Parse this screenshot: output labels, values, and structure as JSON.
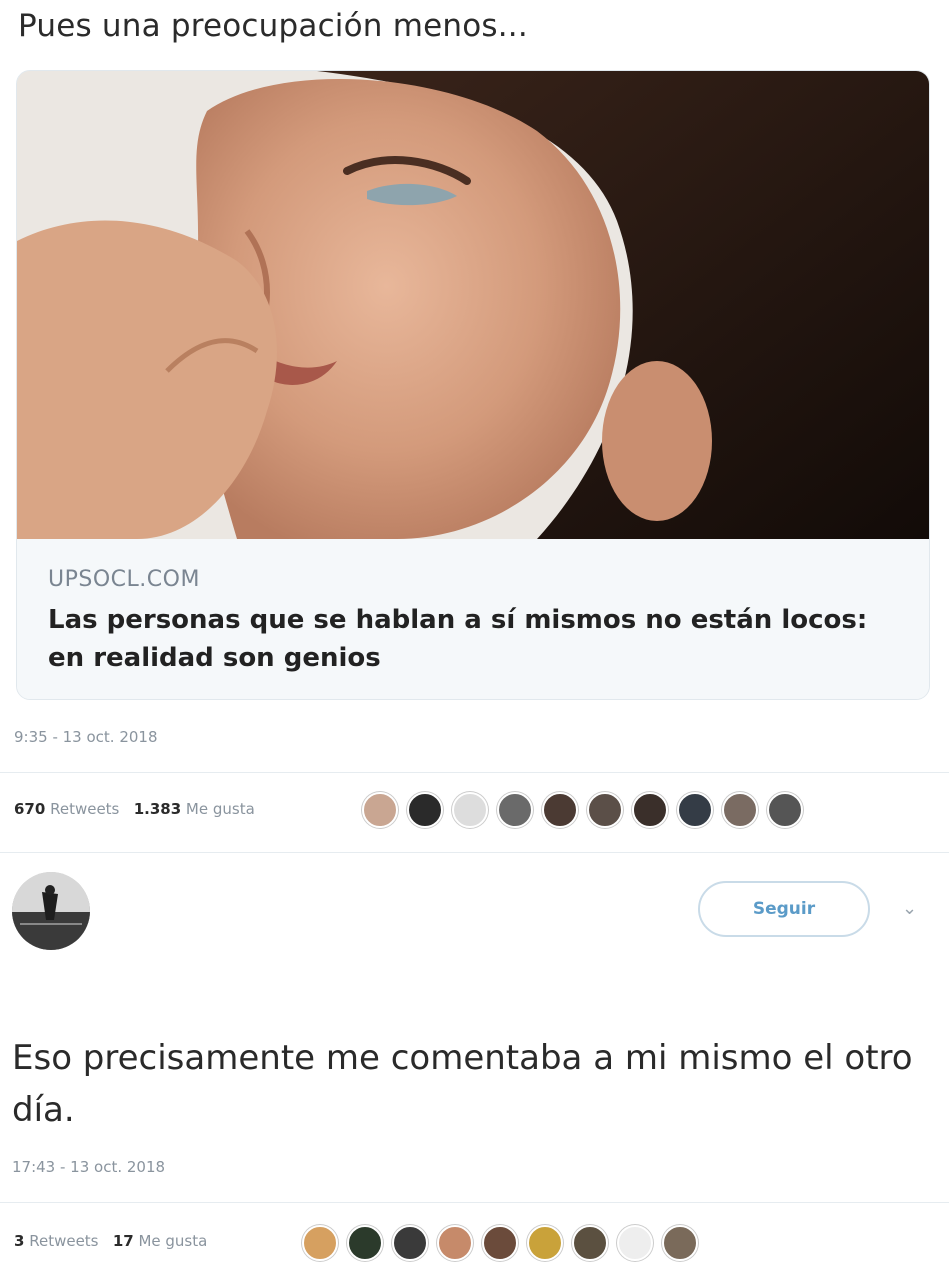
{
  "tweet": {
    "text": "Pues una preocupación menos...",
    "card": {
      "domain": "UPSOCL.COM",
      "title": "Las personas que se hablan a sí mismos no están locos: en realidad son genios"
    },
    "timestamp": "9:35 - 13 oct. 2018",
    "retweets_count": "670",
    "retweets_label": "Retweets",
    "likes_count": "1.383",
    "likes_label": "Me gusta"
  },
  "reply": {
    "follow_label": "Seguir",
    "text": "Eso precisamente me comentaba a mi mismo el otro día.",
    "timestamp": "17:43 - 13 oct. 2018",
    "retweets_count": "3",
    "retweets_label": "Retweets",
    "likes_count": "17",
    "likes_label": "Me gusta"
  },
  "icons": {
    "chevron": "chevron-down-icon",
    "avatar": "user-avatar"
  },
  "colors": {
    "follow_text": "#5b9bc8",
    "card_bg": "#f5f8fa"
  }
}
